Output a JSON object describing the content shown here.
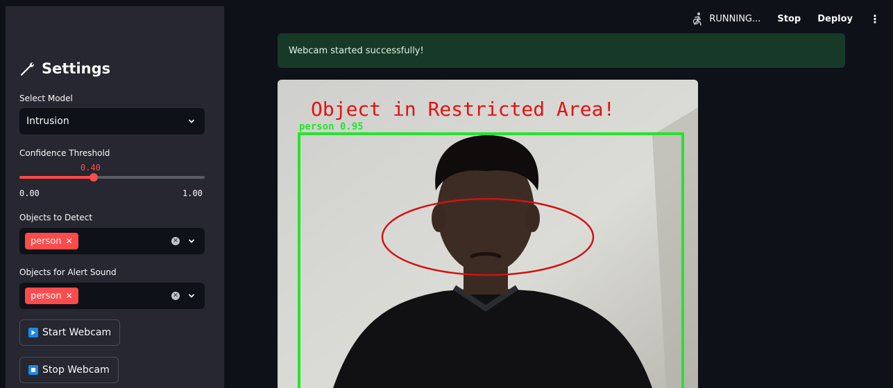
{
  "header": {
    "status": "RUNNING...",
    "stop_label": "Stop",
    "deploy_label": "Deploy",
    "menu_icon": "vertical-dots-icon",
    "status_icon": "running-figure-icon"
  },
  "sidebar": {
    "title": "Settings",
    "title_icon": "wrench-icon",
    "model_label": "Select Model",
    "model_value": "Intrusion",
    "confidence_label": "Confidence Threshold",
    "confidence_value": "0.40",
    "confidence_level": 0.4,
    "confidence_min": "0.00",
    "confidence_max": "1.00",
    "detect_label": "Objects to Detect",
    "detect_tags": [
      "person"
    ],
    "alert_label": "Objects for Alert Sound",
    "alert_tags": [
      "person"
    ],
    "start_button": "Start Webcam",
    "stop_button": "Stop Webcam"
  },
  "alert": {
    "message": "Webcam started successfully!"
  },
  "video": {
    "overlay_text": "Object in Restricted Area!",
    "detection_label": "person 0.95"
  },
  "colors": {
    "accent": "#ff4b4b",
    "success_bg": "#173928",
    "sidebar_bg": "#262730",
    "main_bg": "#0e1117",
    "detection_box": "#22e62a",
    "overlay_text": "#e31212"
  }
}
